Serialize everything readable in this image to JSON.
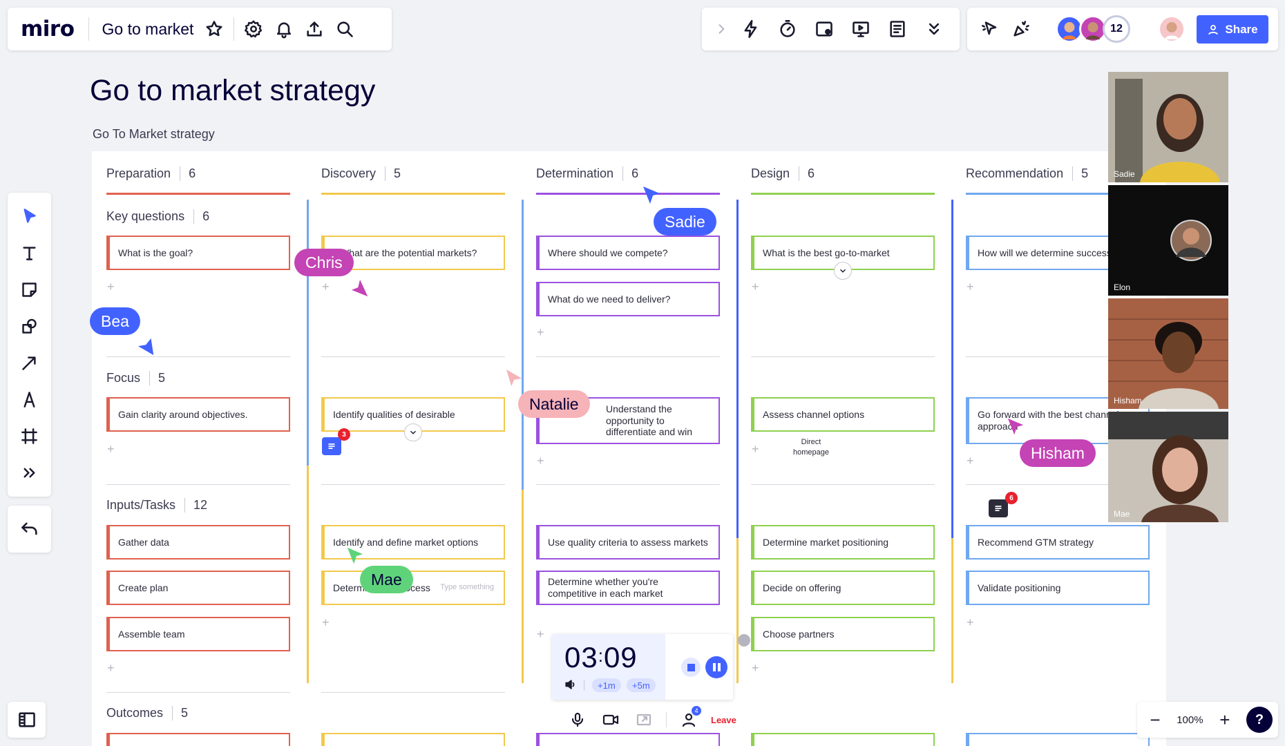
{
  "app": {
    "logo": "miro",
    "board_name": "Go to market"
  },
  "header": {
    "collaborator_count": "12",
    "share_label": "Share"
  },
  "page": {
    "title": "Go to market strategy",
    "subtitle": "Go To Market strategy"
  },
  "columns": [
    {
      "name": "Preparation",
      "count": "6",
      "color": "#e0614e"
    },
    {
      "name": "Discovery",
      "count": "5",
      "color": "#f2c94c"
    },
    {
      "name": "Determination",
      "count": "6",
      "color": "#9b51e0"
    },
    {
      "name": "Design",
      "count": "6",
      "color": "#8fd14f"
    },
    {
      "name": "Recommendation",
      "count": "5",
      "color": "#6fa8ef"
    }
  ],
  "rows": [
    {
      "name": "Key questions",
      "count": "6"
    },
    {
      "name": "Focus",
      "count": "5"
    },
    {
      "name": "Inputs/Tasks",
      "count": "12"
    },
    {
      "name": "Outcomes",
      "count": "5"
    }
  ],
  "cards": {
    "prep_q1": "What is the goal?",
    "prep_f1": "Gain clarity around objectives.",
    "prep_t1": "Gather data",
    "prep_t2": "Create plan",
    "prep_t3": "Assemble team",
    "disc_q1": "What are the potential markets?",
    "disc_f1": "Identify qualities of desirable",
    "disc_t1": "Identify and define market options",
    "disc_t2": "Determine the process",
    "disc_t2_hint": "Type something",
    "det_q1": "Where should we compete?",
    "det_q2": "What do we need to deliver?",
    "det_f1": "Understand the opportunity to differentiate and win",
    "det_t1": "Use quality criteria to assess markets",
    "det_t2": "Determine whether you're competitive in each market",
    "des_q1": "What is the best go-to-market",
    "des_f1": "Assess channel options",
    "des_f1_note": "Direct homepage",
    "des_t1": "Determine market positioning",
    "des_t2": "Decide on offering",
    "des_t3": "Choose partners",
    "rec_q1": "How will we determine success",
    "rec_f1": "Go forward with the best channel approach",
    "rec_t1": "Recommend GTM strategy",
    "rec_t2": "Validate positioning"
  },
  "cursors": [
    {
      "name": "Sadie",
      "color": "#4262ff"
    },
    {
      "name": "Chris",
      "color": "#c443b5"
    },
    {
      "name": "Bea",
      "color": "#4262ff"
    },
    {
      "name": "Natalie",
      "color": "#f6b3b8"
    },
    {
      "name": "Hisham",
      "color": "#c443b5"
    },
    {
      "name": "Mae",
      "color": "#5fd37a"
    }
  ],
  "comments": [
    {
      "count": "3",
      "color": "#4262ff"
    },
    {
      "count": "6",
      "color": "#2b2b3a"
    }
  ],
  "video_tiles": [
    "Sadie",
    "Elon",
    "Hisham",
    "Mae"
  ],
  "timer": {
    "minutes": "03",
    "seconds": "09",
    "add1": "+1m",
    "add5": "+5m"
  },
  "talktrack": {
    "participants_badge": "4",
    "leave_label": "Leave"
  },
  "zoom": {
    "level": "100%"
  },
  "help": {
    "label": "?"
  }
}
